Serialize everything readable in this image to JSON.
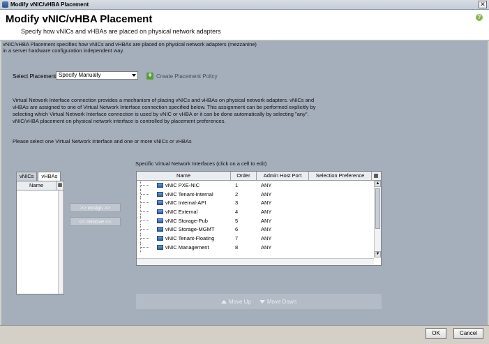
{
  "window": {
    "title": "Modify vNIC/vHBA Placement"
  },
  "header": {
    "title": "Modify vNIC/vHBA Placement",
    "subtitle": "Specify how vNICs and vHBAs are placed on physical network adapters"
  },
  "description": "vNIC/vHBA Placement specifies how vNICs and vHBAs are placed on physical network adapters (mezzanine)\nin a server hardware configuration independent way.",
  "placement": {
    "label": "Select Placement:",
    "value": "Specify Manually",
    "create_policy": "Create Placement Policy"
  },
  "info_text": "Virtual Network Interface connection provides a mechanism of placing vNICs and vHBAs on physical network adapters. vNICs and vHBAs are assigned to one of Virtual Network Interface connection specified below. This assignment can be performed explicitly by selecting which Virtual Network Interface connection is used by vNIC or vHBA or it can be done automatically by selecting \"any\". vNIC/vHBA placement on physical network interface is controlled by placement preferences.",
  "select_hint": "Please select one Virtual Network Interface and one or more vNICs or vHBAs",
  "left_panel": {
    "tabs": [
      "vNICs",
      "vHBAs"
    ],
    "column_name": "Name",
    "assign_label": ">> assign >>",
    "remove_label": "<< remove <<"
  },
  "right_panel": {
    "label": "Specific Virtual Network Interfaces (click on a cell to edit)",
    "columns": [
      "Name",
      "Order",
      "Admin Host Port",
      "Selection Preference"
    ],
    "rows": [
      {
        "name": "vNIC PXE-NIC",
        "order": "1",
        "admin": "ANY"
      },
      {
        "name": "vNIC Tenant-Internal",
        "order": "2",
        "admin": "ANY"
      },
      {
        "name": "vNIC Internal-API",
        "order": "3",
        "admin": "ANY"
      },
      {
        "name": "vNIC External",
        "order": "4",
        "admin": "ANY"
      },
      {
        "name": "vNIC Storage-Pub",
        "order": "5",
        "admin": "ANY"
      },
      {
        "name": "vNIC Storage-MGMT",
        "order": "6",
        "admin": "ANY"
      },
      {
        "name": "vNIC Tenant-Floating",
        "order": "7",
        "admin": "ANY"
      },
      {
        "name": "vNIC Management",
        "order": "8",
        "admin": "ANY"
      }
    ],
    "move_up": "Move Up",
    "move_down": "Move Down"
  },
  "footer": {
    "ok": "OK",
    "cancel": "Cancel"
  }
}
